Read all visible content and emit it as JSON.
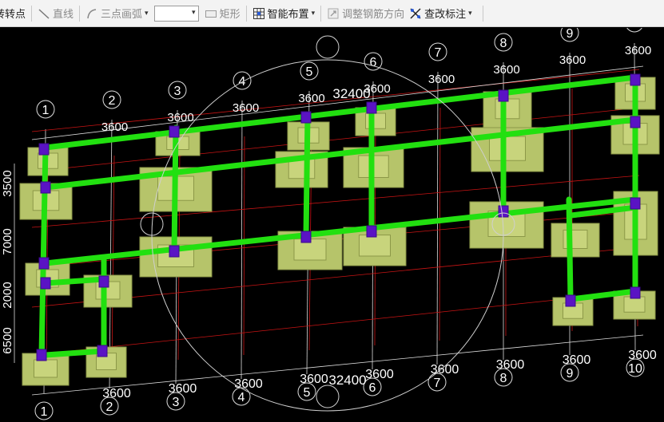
{
  "toolbar": {
    "rotate_point": "转转点",
    "line": "直线",
    "three_point_arc": "三点画弧",
    "combo_value": "",
    "rectangle": "矩形",
    "smart_layout": "智能布置",
    "adjust_rebar": "调整钢筋方向",
    "check_annotation": "查改标注"
  },
  "axes": {
    "numbers": [
      "1",
      "2",
      "3",
      "4",
      "5",
      "6",
      "7",
      "8",
      "9",
      "10"
    ],
    "top_dims": [
      "3600",
      "3600",
      "3600",
      "3600",
      "3600",
      "3600",
      "3600",
      "3600",
      "3600"
    ],
    "bottom_dims": [
      "3600",
      "3600",
      "3600",
      "3600",
      "3600",
      "3600",
      "3600",
      "3600",
      "3600"
    ],
    "top_total": "32400",
    "bottom_total": "32400",
    "left_dims": [
      "3500",
      "7000",
      "2000",
      "6500"
    ]
  },
  "colors": {
    "beam": "#22e010",
    "footing": "#b6c46a",
    "column": "#5a13c4",
    "grid_red": "#c81414",
    "axis_white": "#dddddd"
  }
}
